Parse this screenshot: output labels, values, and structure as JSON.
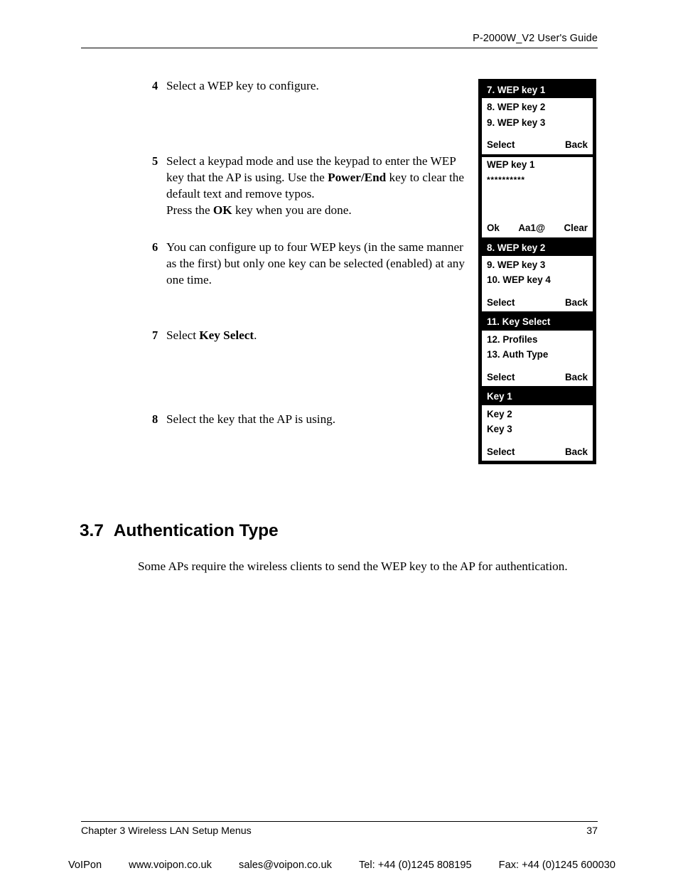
{
  "header": {
    "title": "P-2000W_V2 User's Guide"
  },
  "steps": [
    {
      "number": "4",
      "text_parts": [
        {
          "text": "Select a WEP key to configure.",
          "bold": false
        }
      ]
    },
    {
      "number": "5",
      "text_parts": [
        {
          "text": "Select a keypad mode and use the keypad to enter the WEP key that the AP is using. Use the ",
          "bold": false
        },
        {
          "text": "Power/End",
          "bold": true
        },
        {
          "text": " key to clear the default text and remove typos.",
          "bold": false
        },
        {
          "text": "\nPress the ",
          "bold": false
        },
        {
          "text": "OK",
          "bold": true
        },
        {
          "text": " key when you are done.",
          "bold": false
        }
      ]
    },
    {
      "number": "6",
      "text_parts": [
        {
          "text": "You can configure up to four WEP keys (in the same manner as the first) but only one key can be selected (enabled) at any one time.",
          "bold": false
        }
      ]
    },
    {
      "number": "7",
      "text_parts": [
        {
          "text": "Select ",
          "bold": false
        },
        {
          "text": "Key Select",
          "bold": true
        },
        {
          "text": ".",
          "bold": false
        }
      ]
    },
    {
      "number": "8",
      "text_parts": [
        {
          "text": "Select the key that the AP is using.",
          "bold": false
        }
      ]
    }
  ],
  "section": {
    "number": "3.7",
    "title": "Authentication Type",
    "body": "Some APs require the wireless clients to send the WEP key to the AP for authentication."
  },
  "lcd_screens": [
    {
      "id": "wep-key-list-1",
      "title": "7. WEP key 1",
      "title_highlighted": true,
      "items": [
        "8. WEP key 2",
        "9. WEP key 3"
      ],
      "softkeys": {
        "left": "Select",
        "middle": "",
        "right": "Back"
      }
    },
    {
      "id": "wep-key-entry",
      "title": "WEP key 1",
      "title_highlighted": false,
      "value_mask": "**********",
      "items": [],
      "softkeys": {
        "left": "Ok",
        "middle": "Aa1@",
        "right": "Clear"
      }
    },
    {
      "id": "wep-key-list-2",
      "title": "8. WEP key 2",
      "title_highlighted": true,
      "items": [
        "9. WEP key 3",
        "10. WEP key 4"
      ],
      "softkeys": {
        "left": "Select",
        "middle": "",
        "right": "Back"
      }
    },
    {
      "id": "key-select-menu",
      "title": "11. Key Select",
      "title_highlighted": true,
      "items": [
        "12. Profiles",
        "13. Auth Type"
      ],
      "softkeys": {
        "left": "Select",
        "middle": "",
        "right": "Back"
      }
    },
    {
      "id": "key-choice-list",
      "title": "Key 1",
      "title_highlighted": true,
      "items": [
        "Key 2",
        "Key 3"
      ],
      "softkeys": {
        "left": "Select",
        "middle": "",
        "right": "Back"
      }
    }
  ],
  "footer": {
    "chapter": "Chapter 3 Wireless LAN Setup Menus",
    "page_number": "37"
  },
  "watermark": {
    "brand": "VoIPon",
    "website": "www.voipon.co.uk",
    "email": "sales@voipon.co.uk",
    "tel": "Tel: +44 (0)1245 808195",
    "fax": "Fax: +44 (0)1245 600030"
  }
}
